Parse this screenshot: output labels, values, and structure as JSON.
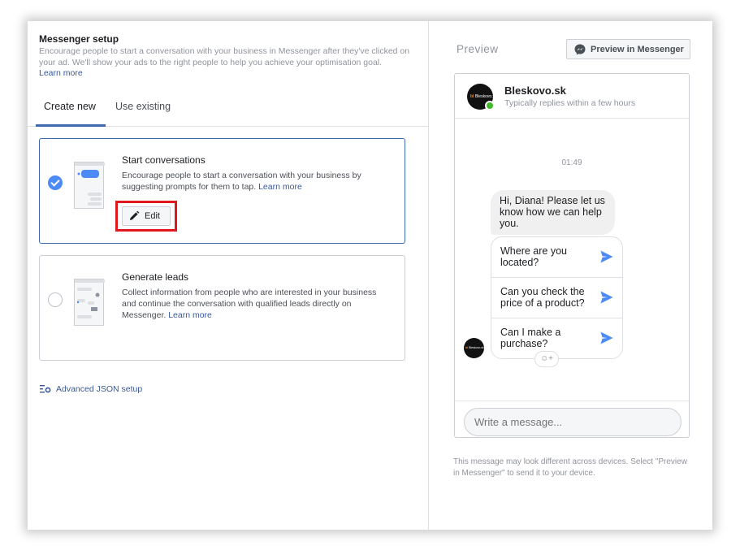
{
  "setup": {
    "title": "Messenger setup",
    "description": "Encourage people to start a conversation with your business in Messenger after they've clicked on your ad. We'll show your ads to the right people to help you achieve your optimisation goal.",
    "learn_more": "Learn more"
  },
  "tabs": [
    {
      "label": "Create new",
      "active": true
    },
    {
      "label": "Use existing",
      "active": false
    }
  ],
  "cards": {
    "start": {
      "title": "Start conversations",
      "description": "Encourage people to start a conversation with your business by suggesting prompts for them to tap.",
      "learn_more": "Learn more",
      "edit_label": "Edit",
      "selected": true
    },
    "leads": {
      "title": "Generate leads",
      "description": "Collect information from people who are interested in your business and continue the conversation with qualified leads directly on Messenger.",
      "learn_more": "Learn more",
      "selected": false
    }
  },
  "advanced": {
    "label": "Advanced JSON setup"
  },
  "preview": {
    "label": "Preview",
    "button_label": "Preview in Messenger",
    "business_name": "Bleskovo.sk",
    "business_status": "Typically replies within a few hours",
    "logo_text_accent": "bl",
    "logo_text": "Bleskovo.sk",
    "time": "01:49",
    "greeting": "Hi, Diana! Please let us know how we can help you.",
    "prompts": [
      "Where are you located?",
      "Can you check the price of a product?",
      "Can I make a purchase?"
    ],
    "reaction": "☺+",
    "input_placeholder": "Write a message...",
    "note": "This message may look different across devices. Select \"Preview in Messenger\" to send it to your device."
  },
  "colors": {
    "accent": "#4267b2",
    "link": "#385898",
    "highlight_box": "#e0181e",
    "check": "#4c8bf5",
    "send": "#4c8bf5"
  }
}
